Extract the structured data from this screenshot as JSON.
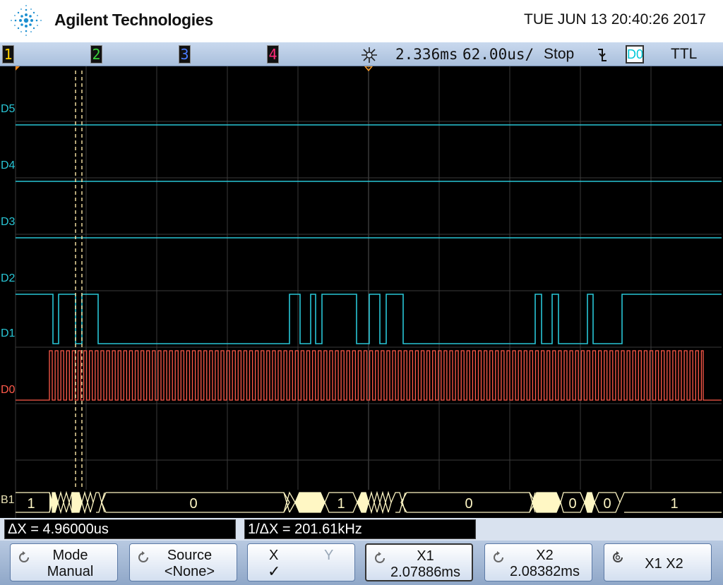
{
  "header": {
    "brand": "Agilent Technologies",
    "datetime": "TUE JUN 13 20:40:26 2017"
  },
  "statusbar": {
    "channels": [
      {
        "label": "1",
        "color": "#ffd000"
      },
      {
        "label": "2",
        "color": "#3bd33b"
      },
      {
        "label": "3",
        "color": "#4a7cff"
      },
      {
        "label": "4",
        "color": "#ff2a7a"
      }
    ],
    "time_position": "2.336ms",
    "time_scale": "62.00us/",
    "run_state": "Stop",
    "trigger_source": "D0",
    "trigger_level": "TTL",
    "icons": {
      "time": "time-reference-icon",
      "trigger": "falling-edge-trigger-icon"
    }
  },
  "scope": {
    "digital_labels": [
      "D5",
      "D4",
      "D3",
      "D2",
      "D1",
      "D0"
    ],
    "bus_label": "B1",
    "bus_values": [
      "1",
      "0",
      "1",
      "0",
      "0",
      "0",
      "1"
    ],
    "colors": {
      "digital": "#29c6d6",
      "d0": "#ff5a4a",
      "bus": "#fff7c4",
      "cursor": "#ffe9a8",
      "grid": "#3a3a3a"
    }
  },
  "measurements": {
    "delta_x": "ΔX = 4.96000us",
    "inv_delta_x": "1/ΔX = 201.61kHz"
  },
  "softkeys": {
    "mode": {
      "line1": "Mode",
      "line2": "Manual"
    },
    "source": {
      "line1": "Source",
      "line2": "<None>"
    },
    "xy": {
      "x": "X",
      "y": "Y",
      "check": "✓"
    },
    "x1": {
      "line1": "X1",
      "line2": "2.07886ms"
    },
    "x2": {
      "line1": "X2",
      "line2": "2.08382ms"
    },
    "x1x2": {
      "line1": "X1 X2"
    }
  }
}
